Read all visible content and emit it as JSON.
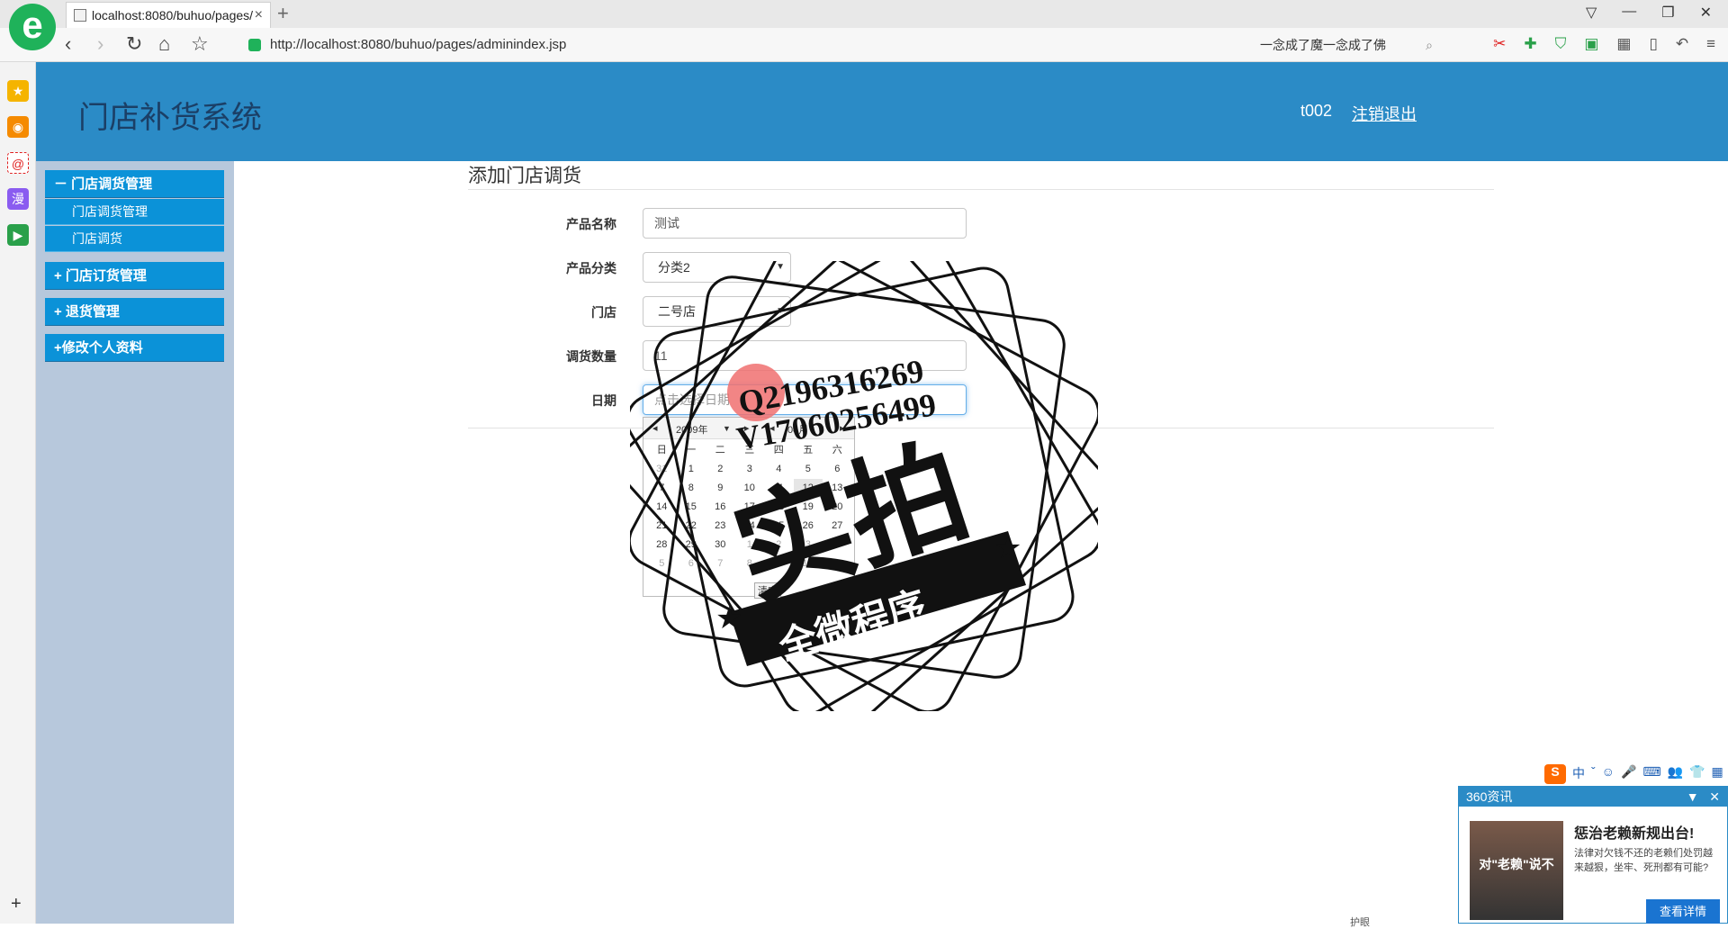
{
  "browser": {
    "tab_title": "localhost:8080/buhuo/pages/",
    "tab_close": "×",
    "new_tab": "+",
    "url": "http://localhost:8080/buhuo/pages/adminindex.jsp",
    "search_text": "一念成了魔一念成了佛",
    "logo_glyph": "e"
  },
  "header": {
    "title": "门店补货系统",
    "username": "t002",
    "logout": "注销退出"
  },
  "sidebar": {
    "groups": [
      {
        "label": "－ 门店调货管理",
        "items": [
          "门店调货管理",
          "门店调货"
        ]
      },
      {
        "label": "+ 门店订货管理"
      },
      {
        "label": "+ 退货管理"
      },
      {
        "label": "+修改个人资料"
      }
    ]
  },
  "form": {
    "title": "添加门店调货",
    "fields": [
      {
        "label": "产品名称",
        "value": "测试"
      },
      {
        "label": "产品分类",
        "value": "分类2"
      },
      {
        "label": "门店",
        "value": "二号店"
      },
      {
        "label": "调货数量",
        "value": "11"
      },
      {
        "label": "日期",
        "placeholder": "点击选择日期"
      }
    ]
  },
  "datepicker": {
    "year": "2009年",
    "month": "04月",
    "weekdays": [
      "日",
      "一",
      "二",
      "三",
      "四",
      "五",
      "六"
    ],
    "rows": [
      [
        "31",
        "1",
        "2",
        "3",
        "4",
        "5",
        "6"
      ],
      [
        "7",
        "8",
        "9",
        "10",
        "11",
        "12",
        "13"
      ],
      [
        "14",
        "15",
        "16",
        "17",
        "18",
        "19",
        "20"
      ],
      [
        "21",
        "22",
        "23",
        "24",
        "25",
        "26",
        "27"
      ],
      [
        "28",
        "29",
        "30",
        "1",
        "2",
        "3",
        "4"
      ],
      [
        "5",
        "6",
        "7",
        "8",
        "9",
        "10",
        "11"
      ]
    ],
    "clear": "清空"
  },
  "watermark": {
    "line1": "Q2196316269",
    "line2": "V17060256499",
    "big": "实拍",
    "banner": "全微程序"
  },
  "ime": [
    "中",
    "ˇ",
    "☺",
    "🎤",
    "⌨",
    "👥",
    "👕",
    "▦"
  ],
  "news": {
    "header": "360资讯",
    "title": "惩治老赖新规出台!",
    "text": "法律对欠钱不还的老赖们处罚越来越狠，坐牢、死刑都有可能?",
    "button": "查看详情",
    "image_caption": "对\"老赖\"说不"
  },
  "statusbar": "护眼"
}
